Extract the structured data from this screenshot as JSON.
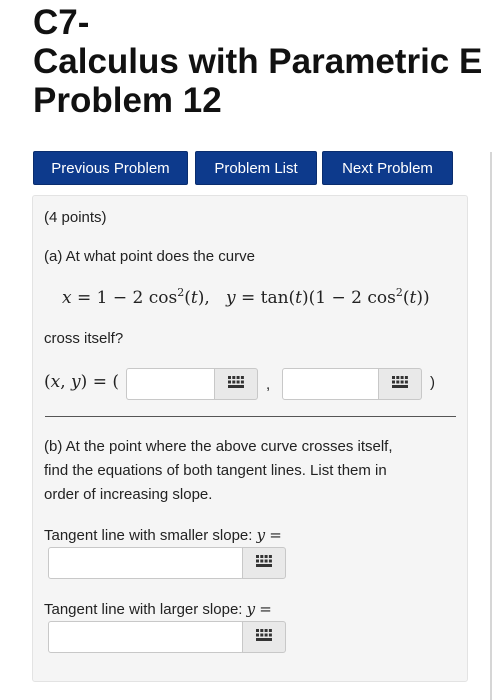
{
  "header": {
    "title_line1": "C7-",
    "title_line2": "Calculus with Parametric E",
    "title_line3": "Problem 12"
  },
  "nav": {
    "previous": "Previous Problem",
    "list": "Problem List",
    "next": "Next Problem"
  },
  "problem": {
    "points": "(4 points)",
    "part_a_intro": "(a) At what point does the curve",
    "equation": "x = 1 − 2 cos²(t),  y = tan(t)(1 − 2 cos²(t))",
    "part_a_end": "cross itself?",
    "point_label": "(x, y) = (",
    "point_sep": ",",
    "point_close": ")",
    "x_value": "",
    "y_value": "",
    "part_b_line1": "(b) At the point where the above curve crosses itself,",
    "part_b_line2": "find the equations of both tangent lines. List them in",
    "part_b_line3": "order of increasing slope.",
    "tangent_small_label": "Tangent line with smaller slope: y =",
    "tangent_large_label": "Tangent line with larger slope: y =",
    "tangent_small_value": "",
    "tangent_large_value": ""
  },
  "icons": {
    "keypad": "math-keypad-icon"
  },
  "colors": {
    "nav_button_bg": "#0d3a8c",
    "panel_bg": "#f5f5f5"
  }
}
